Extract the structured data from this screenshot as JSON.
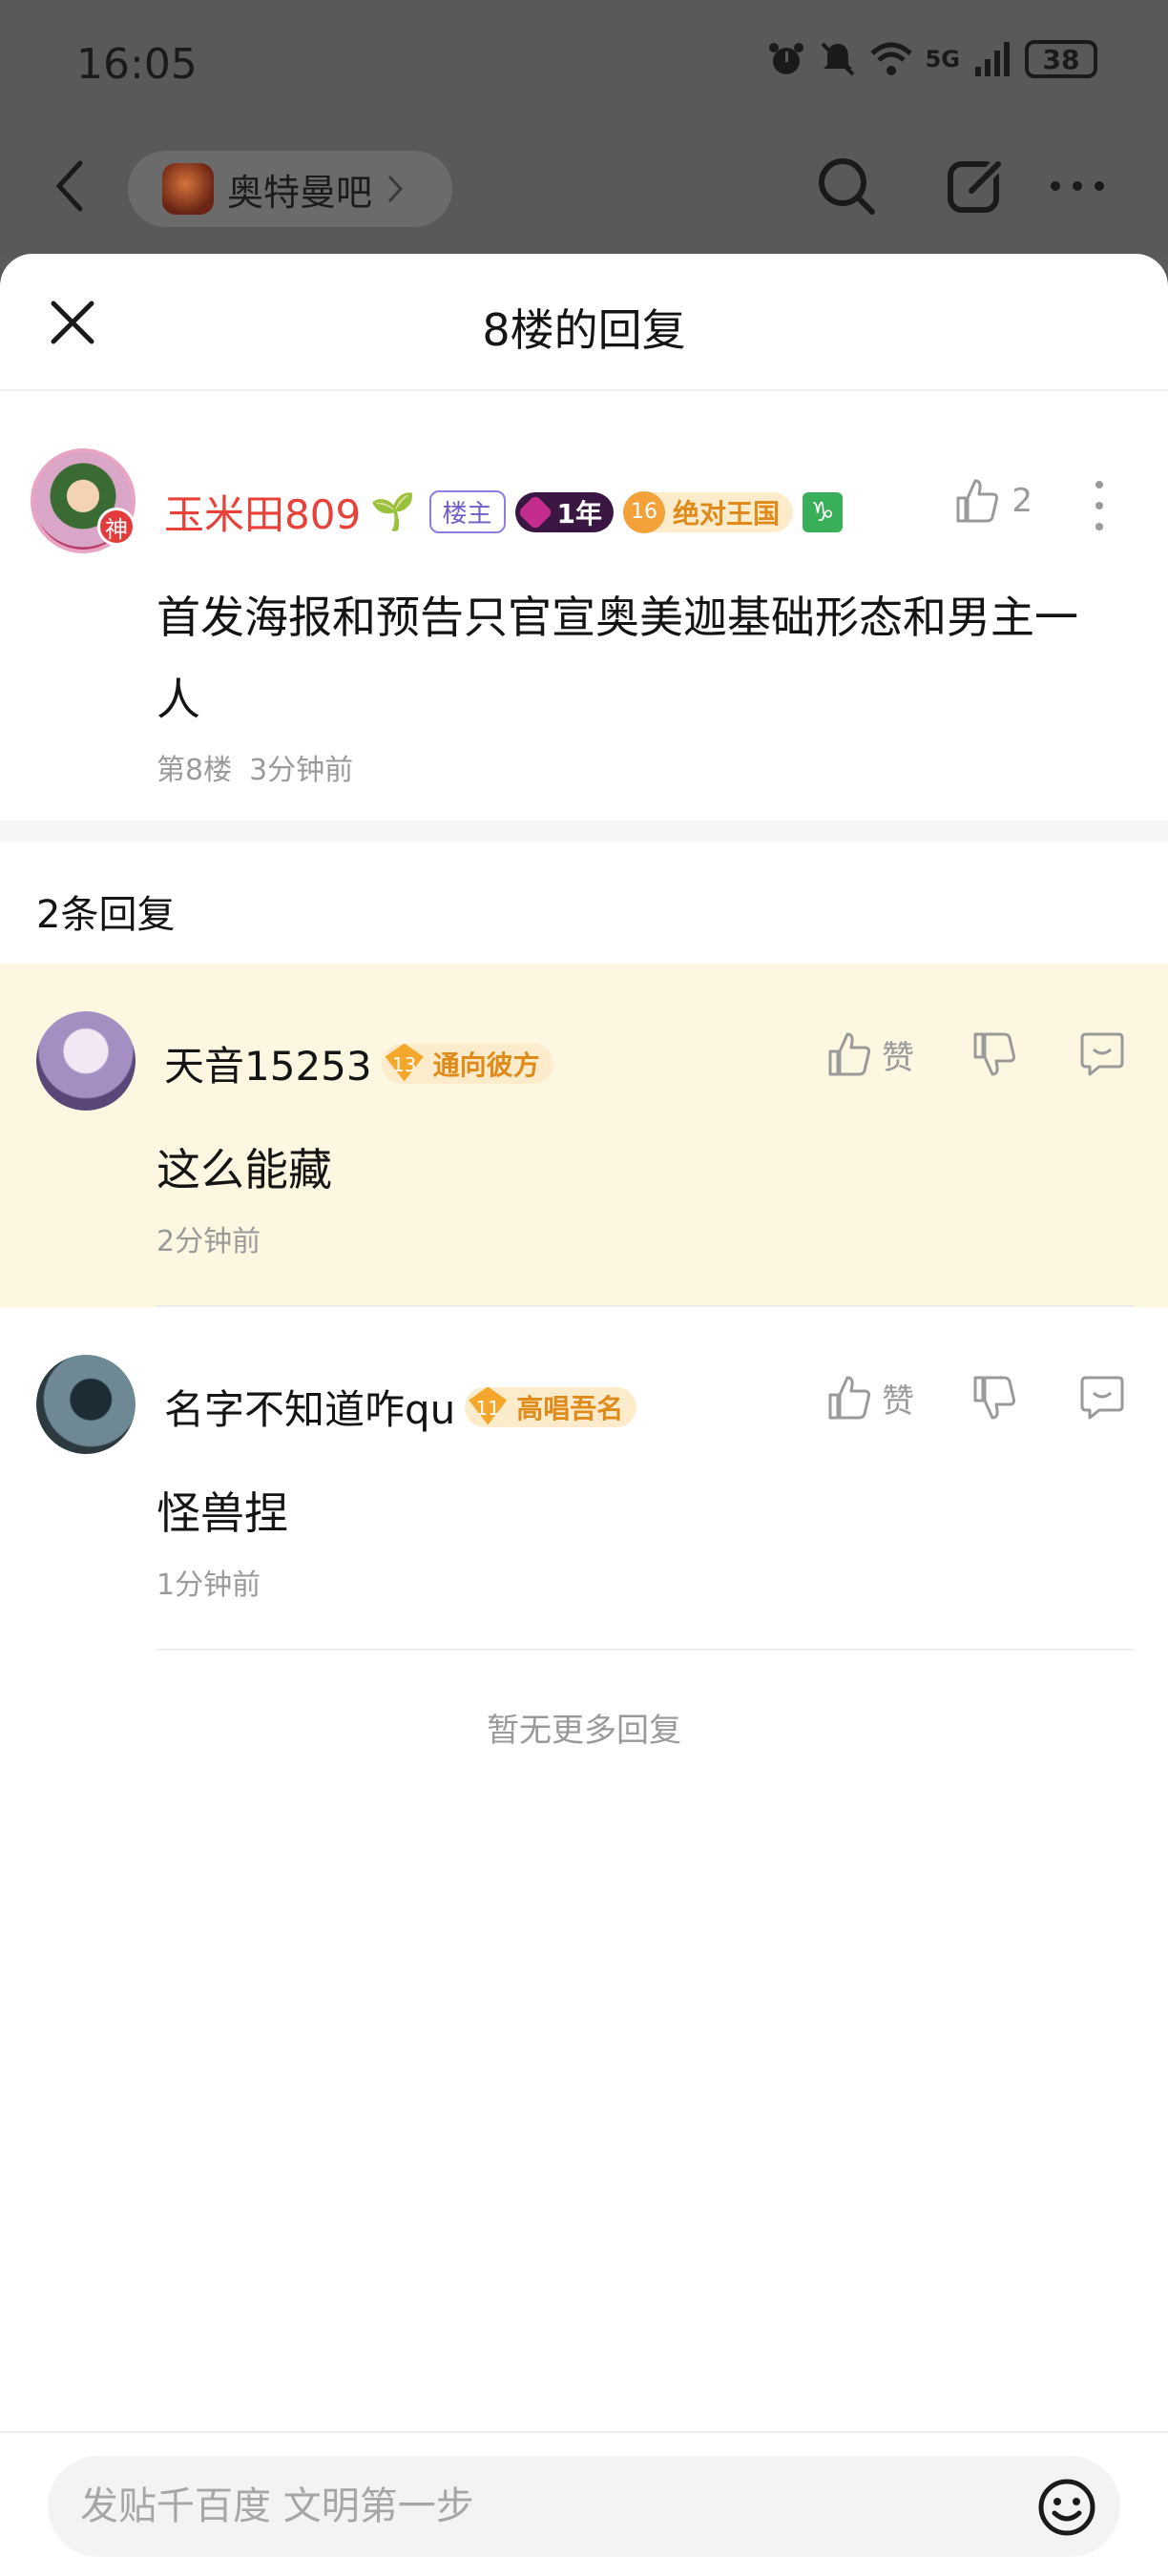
{
  "status_bar": {
    "time": "16:05",
    "network": "5G",
    "battery": "38",
    "icons": [
      "alarm-icon",
      "mute-icon",
      "wifi-icon",
      "signal-icon"
    ]
  },
  "top_nav": {
    "forum_name": "奥特曼吧",
    "icons": [
      "back-icon",
      "search-icon",
      "edit-icon",
      "more-icon"
    ]
  },
  "sheet": {
    "title": "8楼的回复"
  },
  "main_post": {
    "username": "玉米田809",
    "username_emoji": "🌱",
    "avatar_badge": "神",
    "tags": {
      "owner": "楼主",
      "years": "1年",
      "level": "16",
      "level_title": "绝对王国",
      "zodiac": "♑"
    },
    "like_count": "2",
    "content": "首发海报和预告只官宣奥美迦基础形态和男主一人",
    "floor": "第8楼",
    "time": "3分钟前"
  },
  "reply_count": "2条回复",
  "replies": [
    {
      "username": "天音15253",
      "level": "13",
      "level_title": "通向彼方",
      "content": "这么能藏",
      "time": "2分钟前",
      "like_label": "赞",
      "highlighted": true
    },
    {
      "username": "名字不知道咋qu",
      "level": "11",
      "level_title": "高唱吾名",
      "content": "怪兽捏",
      "time": "1分钟前",
      "like_label": "赞",
      "highlighted": false
    }
  ],
  "no_more": "暂无更多回复",
  "composer": {
    "placeholder": "发贴千百度 文明第一步"
  },
  "colors": {
    "username_red": "#e8413a",
    "level_orange": "#e08a1a",
    "highlight_bg": "#fdf7e2",
    "muted": "#9a9a9a"
  }
}
